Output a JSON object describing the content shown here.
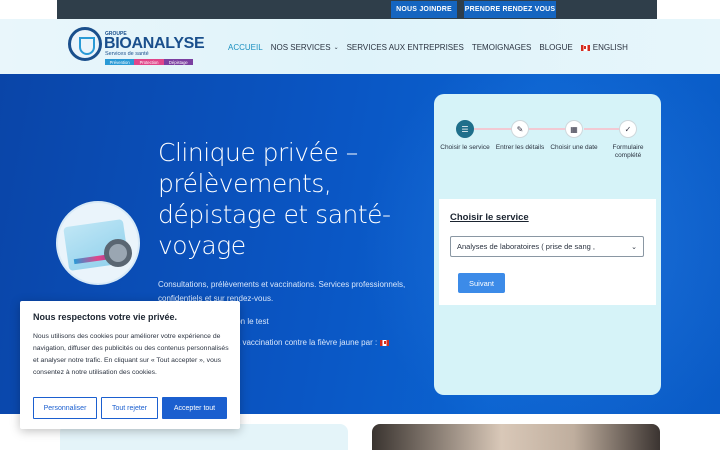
{
  "topbar": {
    "join_label": "NOUS JOINDRE",
    "rdv_label": "PRENDRE RENDEZ VOUS"
  },
  "logo": {
    "groupe": "GROUPE",
    "brand": "BIOANALYSE",
    "sub": "Services de santé",
    "tags": [
      "Prévention",
      "Protection",
      "Dépistage"
    ]
  },
  "nav": {
    "items": [
      "ACCUEIL",
      "NOS SERVICES",
      "SERVICES AUX ENTREPRISES",
      "TEMOIGNAGES",
      "BLOGUE",
      "ENGLISH"
    ]
  },
  "hero": {
    "title": "Clinique privée – prélèvements, dépistage et santé-voyage",
    "desc": "Consultations, prélèvements et vaccinations. Services professionnels, confidentiels et sur rendez-vous.",
    "line2": "elon le test",
    "line3": "la vaccination contre la fièvre jaune par :"
  },
  "widget": {
    "steps": [
      {
        "label": "Choisir le service",
        "icon": "list-icon",
        "active": true
      },
      {
        "label": "Entrer les détails",
        "icon": "clipboard-icon",
        "active": false
      },
      {
        "label": "Choisir une date",
        "icon": "calendar-icon",
        "active": false
      },
      {
        "label": "Formulaire complété",
        "icon": "check-icon",
        "active": false
      }
    ],
    "form_title": "Choisir le service",
    "select_value": "Analyses de laboratoires ( prise de sang ,",
    "submit_label": "Suivant"
  },
  "cookie": {
    "title": "Nous respectons votre vie privée.",
    "body": "Nous utilisons des cookies pour améliorer votre expérience de navigation, diffuser des publicités ou des contenus personnalisés et analyser notre trafic. En cliquant sur « Tout accepter », vous consentez à notre utilisation des cookies.",
    "customize_label": "Personnaliser",
    "reject_label": "Tout rejeter",
    "accept_label": "Accepter tout"
  },
  "colors": {
    "primary": "#1565c0",
    "hero": "#0a56c4",
    "accent": "#1a8fbf",
    "widget_bg": "#d6f3f8"
  }
}
